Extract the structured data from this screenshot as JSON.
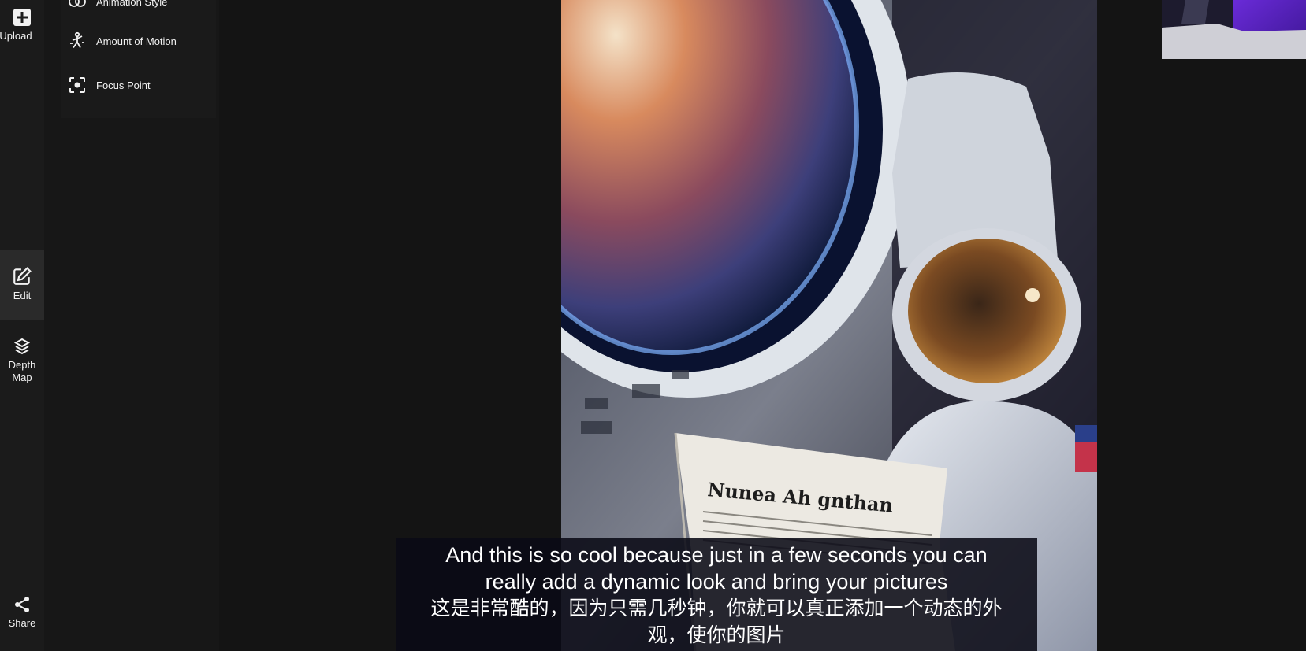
{
  "rail": {
    "upload": {
      "label": "Upload",
      "icon": "plus-square-icon"
    },
    "edit": {
      "label": "Edit",
      "icon": "edit-pencil-icon"
    },
    "depth": {
      "label1": "Depth",
      "label2": "Map",
      "icon": "layers-icon"
    },
    "share": {
      "label": "Share",
      "icon": "share-icon"
    }
  },
  "panel": {
    "options": [
      {
        "label": "Animation Style",
        "icon": "animation-style-icon"
      },
      {
        "label": "Amount of Motion",
        "icon": "motion-icon"
      },
      {
        "label": "Focus Point",
        "icon": "focus-point-icon"
      }
    ]
  },
  "artwork": {
    "newspaper_text": "Nunea Ah gnthan"
  },
  "subtitles": {
    "en_line1": "And this is so cool because just in a few seconds you can",
    "en_line2": "really add a dynamic look and bring your pictures",
    "zh_line1": "这是非常酷的，因为只需几秒钟，你就可以真正添加一个动态的外",
    "zh_line2": "观，使你的图片"
  },
  "colors": {
    "background": "#141414",
    "rail": "#1b1b1b",
    "panel": "#171717",
    "accent_purple": "#6a2bd8"
  }
}
